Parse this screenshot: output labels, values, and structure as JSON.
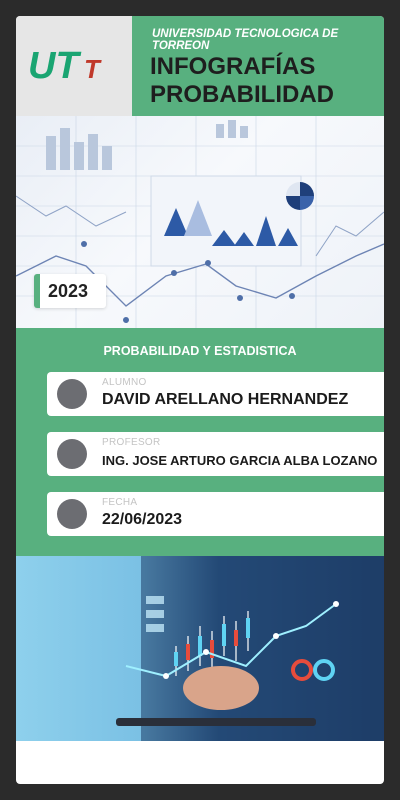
{
  "header": {
    "logo_text": "UTT",
    "university": "UNIVERSIDAD TECNOLOGICA DE TORREON",
    "title_line1": "INFOGRAFÍAS",
    "title_line2": "PROBABILIDAD"
  },
  "year": "2023",
  "subject": "PROBABILIDAD Y ESTADISTICA",
  "rows": [
    {
      "label": "ALUMNO",
      "value": "DAVID ARELLANO HERNANDEZ"
    },
    {
      "label": "PROFESOR",
      "value": "ING. JOSE ARTURO GARCIA ALBA LOZANO"
    },
    {
      "label": "FECHA",
      "value": "22/06/2023"
    }
  ],
  "colors": {
    "accent": "#58b07f",
    "background": "#2b2b2b",
    "dot": "#6c6d72"
  }
}
